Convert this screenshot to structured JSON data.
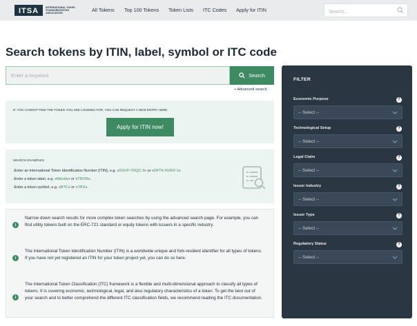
{
  "logo": {
    "mark": "ITSA",
    "subtitle": "INTERNATIONAL TOKEN STANDARDIZATION ASSOCIATION"
  },
  "nav": [
    "All Tokens",
    "Top 100 Tokens",
    "Token Lists",
    "ITC Codes",
    "Apply for ITIN"
  ],
  "top_search": {
    "placeholder": "Search..."
  },
  "page_title": "Search tokens by ITIN, label, symbol or ITC code",
  "keyword": {
    "placeholder": "Enter a keyword",
    "button": "Search"
  },
  "advanced_link": "+ Advanced search",
  "request": {
    "note": "IF YOU CANNOT FIND THE TOKEN YOU ARE LOOKING FOR, YOU CAN REQUEST A NEW ENTRY HERE",
    "button": "Apply for ITIN now!"
  },
  "examples": {
    "title": "SEARCH EXAMPLES",
    "itin": {
      "pre": "-Enter an International Token Identification Number (ITIN), e.g. «",
      "a": "DXVP-YDQC-3",
      "mid": "» or «",
      "b": "DFTK-NVRX-1",
      "post": "»"
    },
    "label": {
      "pre": "-Enter a token label, e.g. «",
      "a": "Bitcoin",
      "mid": "» or «",
      "b": "TRON",
      "post": "»."
    },
    "symbol": {
      "pre": "-Enter a token symbol, e.g. «",
      "a": "BTC",
      "mid": "» or «",
      "b": "TRX",
      "post": "»."
    }
  },
  "info": [
    "Narrow down search results for more complex token searches by using the advanced search page. For example, you can find utility tokens built on the ERC-721 standard or equity tokens with issuers in a specific industry.",
    "The International Token Identification Number (ITIN) is a worldwide unique and fork-resilient identifier for all types of tokens. If you have not yet registered an ITIN for your token project yet, you can do so here.",
    "The International Token Classification (ITC) framework is a flexible and multi-dimensional approach to classify all types of tokens. It is covering economic, technological, legal, and also regulatory characteristics of a token. To get the best out of your search and to better comprehend the different ITC classification fields, we recommend reading the ITC documentation."
  ],
  "filter": {
    "title": "FILTER",
    "select_placeholder": "-- Select --",
    "fields": [
      "Economic Purpose",
      "Technological Setup",
      "Legal Claim",
      "Issuer Industry",
      "Issuer Type",
      "Regulatory Status"
    ]
  },
  "colors": {
    "accent": "#3e8a63",
    "dark_panel": "#2a3642",
    "topbar": "#e9ebed"
  }
}
